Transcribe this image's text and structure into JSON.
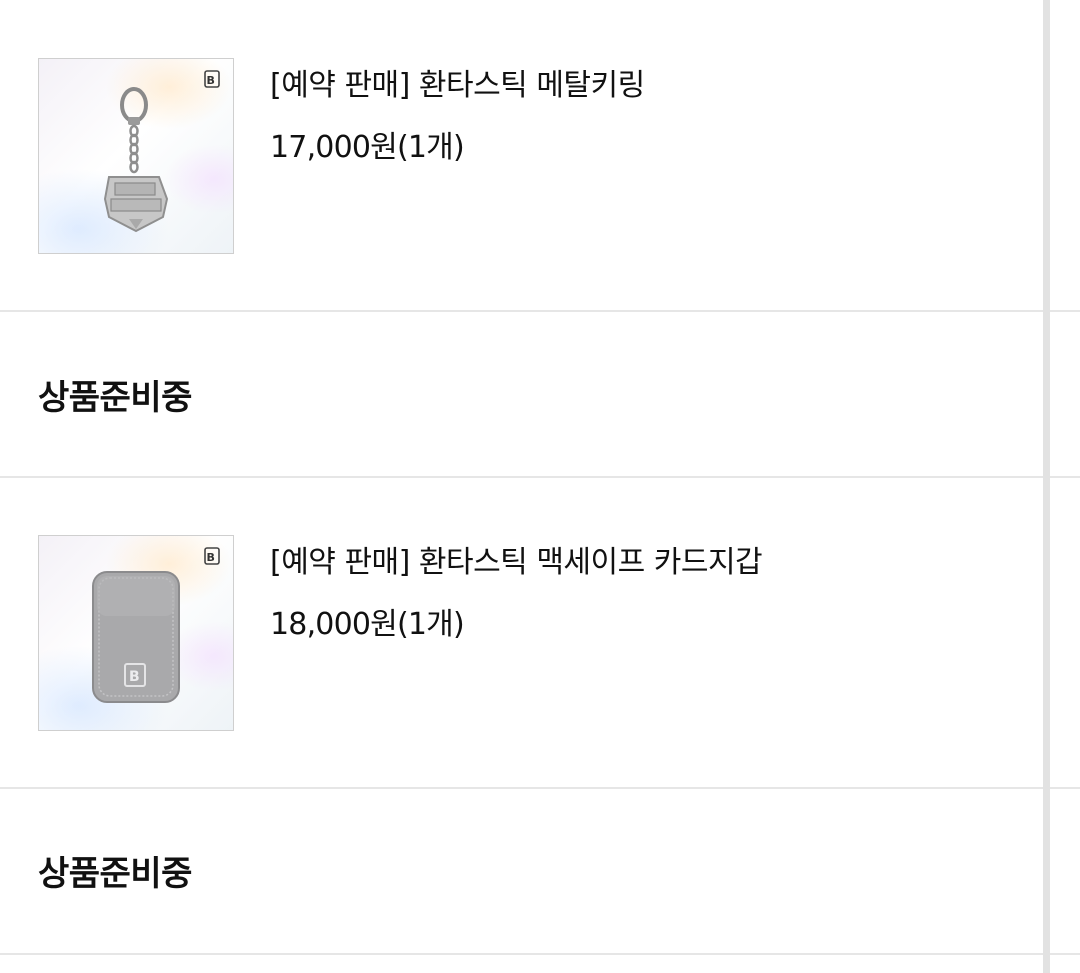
{
  "orders": [
    {
      "product_name": "[예약 판매] 환타스틱 메탈키링",
      "price": "17,000원(1개)",
      "status": "상품준비중",
      "thumbnail_icon": "metal-keyring-image"
    },
    {
      "product_name": "[예약 판매] 환타스틱 맥세이프 카드지갑",
      "price": "18,000원(1개)",
      "status": "상품준비중",
      "thumbnail_icon": "magsafe-card-wallet-image"
    }
  ],
  "colors": {
    "text": "#111111",
    "divider": "#e6e6e6",
    "scrollbar": "#e2e2e2"
  }
}
